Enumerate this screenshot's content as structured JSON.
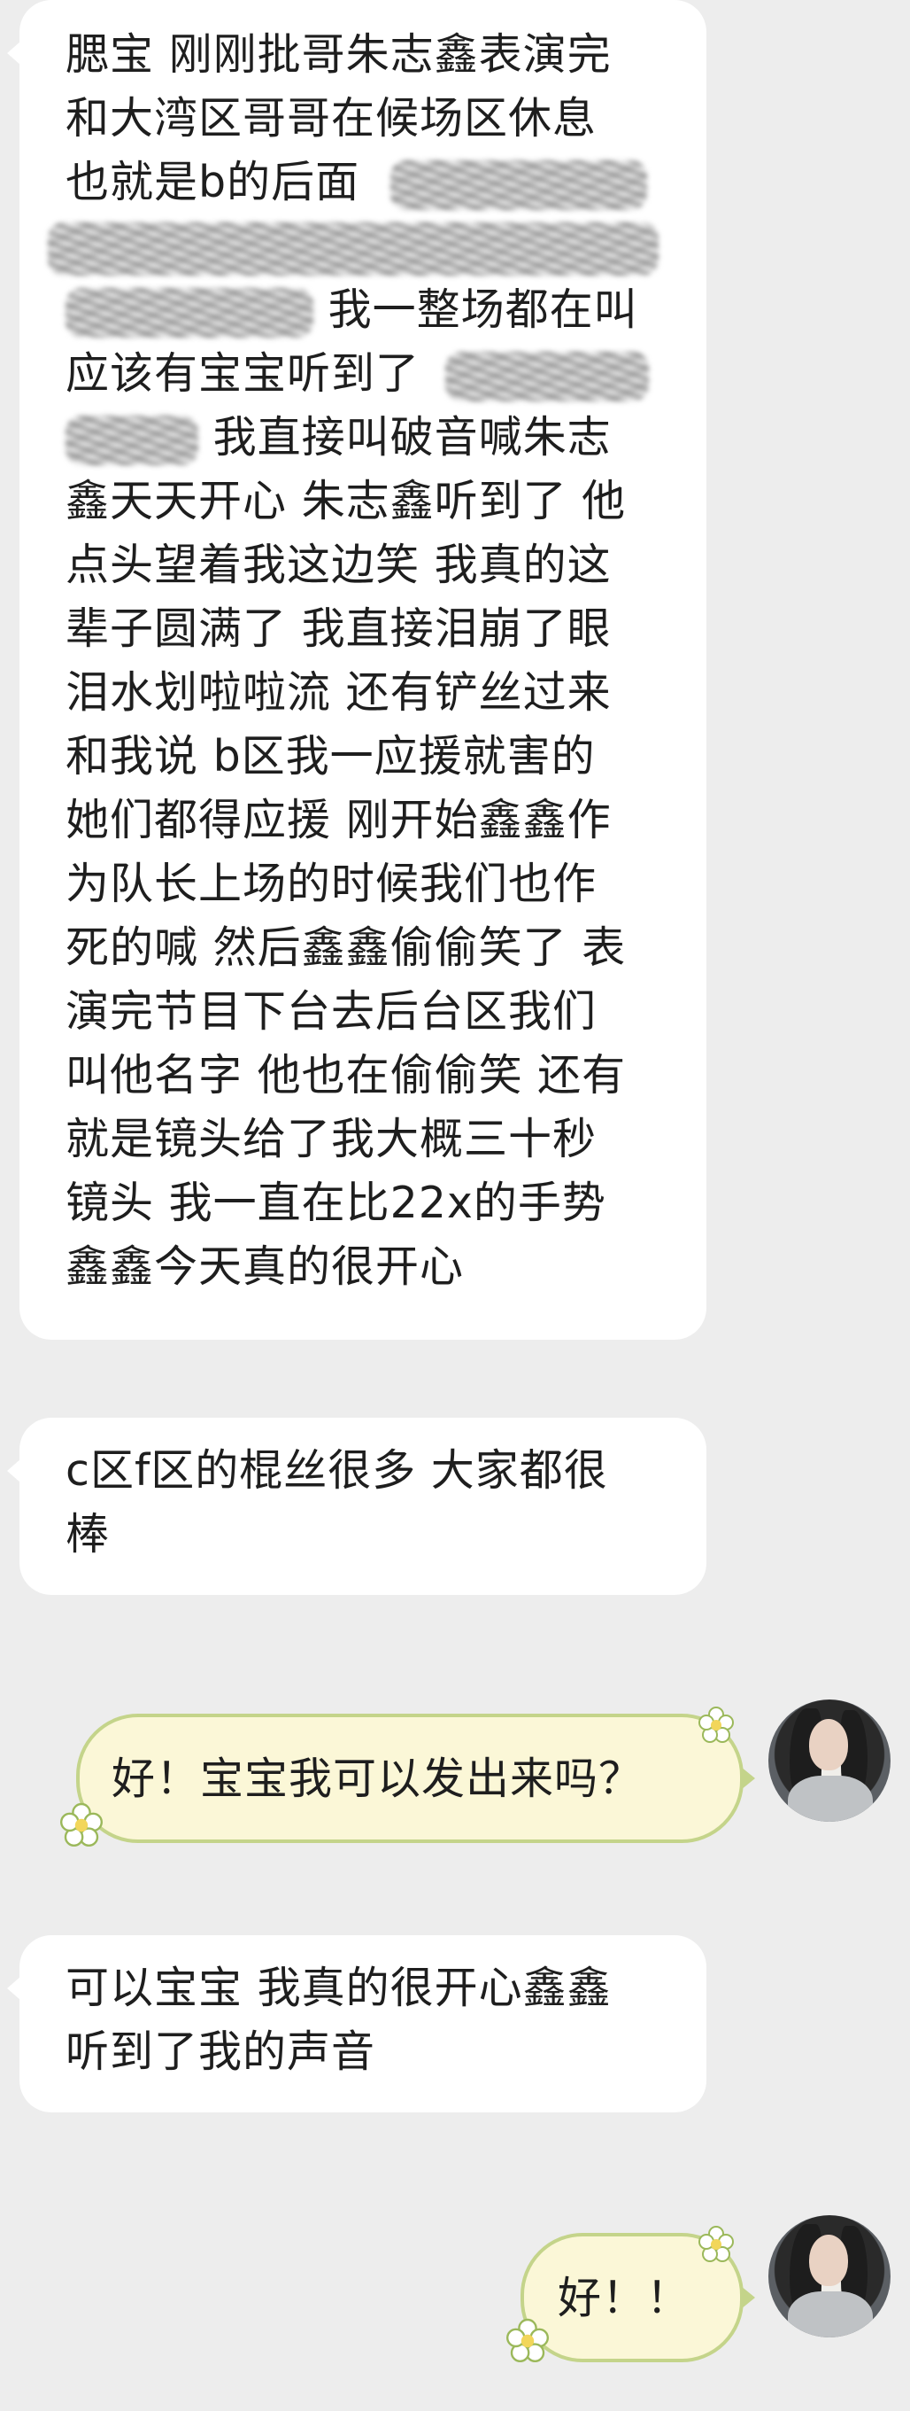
{
  "messages": [
    {
      "sender": "other",
      "lines": [
        "腮宝 刚刚批哥朱志鑫表演完",
        "和大湾区哥哥在候场区休息",
        "也就是b的后面",
        "",
        "我一整场都在叫",
        "应该有宝宝听到了",
        "我直接叫破音喊朱志",
        "鑫天天开心 朱志鑫听到了 他",
        "点头望着我这边笑  我真的这",
        "辈子圆满了 我直接泪崩了眼",
        "泪水划啦啦流 还有铲丝过来",
        "和我说 b区我一应援就害的",
        "她们都得应援  刚开始鑫鑫作",
        "为队长上场的时候我们也作",
        "死的喊 然后鑫鑫偷偷笑了 表",
        "演完节目下台去后台区我们",
        "叫他名字 他也在偷偷笑 还有",
        "就是镜头给了我大概三十秒",
        "镜头 我一直在比22x的手势",
        "鑫鑫今天真的很开心"
      ]
    },
    {
      "sender": "other",
      "lines": [
        "c区f区的棍丝很多 大家都很",
        "棒"
      ]
    },
    {
      "sender": "self",
      "lines": [
        "好！宝宝我可以发出来吗？"
      ]
    },
    {
      "sender": "other",
      "lines": [
        "可以宝宝 我真的很开心鑫鑫",
        "听到了我的声音"
      ]
    },
    {
      "sender": "self",
      "lines": [
        "好！！"
      ]
    }
  ],
  "colors": {
    "background": "#ededed",
    "incoming_bubble": "#ffffff",
    "outgoing_bubble": "#fbf7d7",
    "outgoing_border": "#c4d48a",
    "text": "#1e1e1e"
  },
  "icons": {
    "self_avatar": "avatar-photo",
    "bubble_decoration": "flower-icon"
  }
}
